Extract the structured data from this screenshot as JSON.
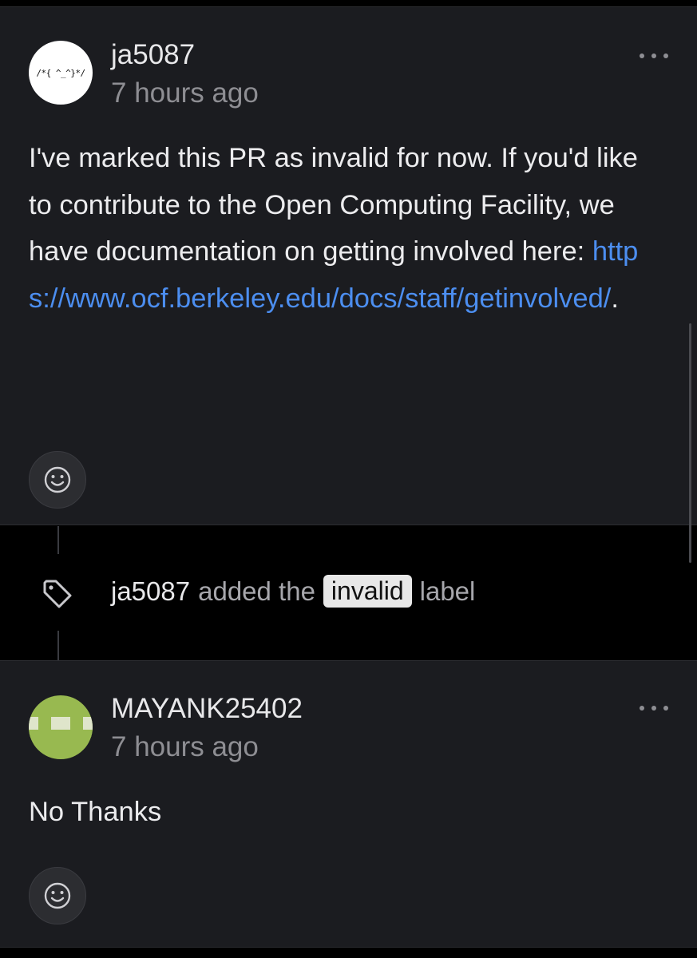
{
  "comments": [
    {
      "author": "ja5087",
      "avatar_text": "/*{ ^_^}*/",
      "time": "7 hours ago",
      "body_text": "I've marked this PR as invalid for now. If you'd like to contribute to the Open Computing Facility, we have documentation on getting involved here: ",
      "body_link": "https://www.ocf.berkeley.edu/docs/staff/getinvolved/",
      "body_suffix": ".",
      "menu_icon": "more-horizontal-icon",
      "reaction_icon": "smiley-icon"
    },
    {
      "author": "MAYANK25402",
      "time": "7 hours ago",
      "body_text": "No Thanks",
      "menu_icon": "more-horizontal-icon",
      "reaction_icon": "smiley-icon"
    }
  ],
  "event": {
    "icon": "tag-icon",
    "user": "ja5087",
    "pre_label": "added the",
    "label": "invalid",
    "post_label": "label"
  },
  "colors": {
    "background": "#000000",
    "card": "#1b1c20",
    "link": "#4c8ef0",
    "muted": "#8e8e93",
    "avatar2": "#98b950"
  }
}
